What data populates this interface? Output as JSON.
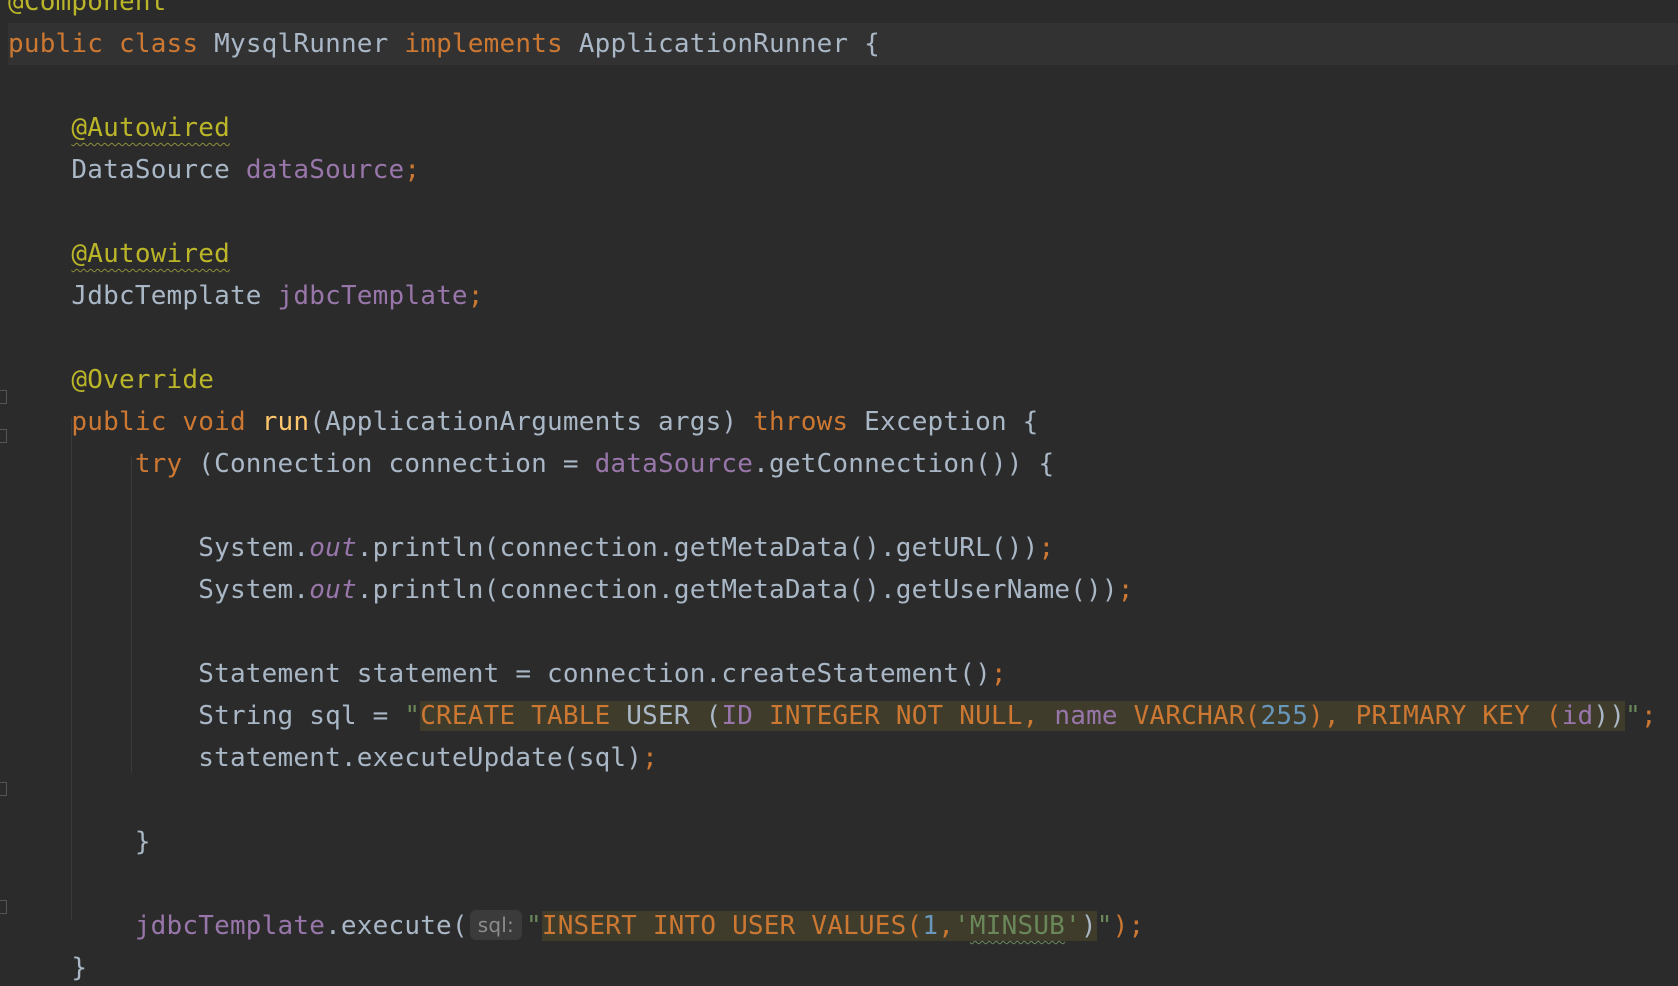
{
  "editor": {
    "lines": {
      "l0": {
        "annotation": "@Component"
      },
      "l1": {
        "kw_public": "public",
        "sp1": " ",
        "kw_class": "class",
        "sp2": " ",
        "class_name": "MysqlRunner",
        "sp3": " ",
        "kw_implements": "implements",
        "sp4": " ",
        "iface": "ApplicationRunner",
        "brace": " {"
      },
      "l3": {
        "indent": "    ",
        "annotation": "@Autowired"
      },
      "l4": {
        "indent": "    ",
        "type": "DataSource",
        "sp": " ",
        "field": "dataSource",
        "semi": ";"
      },
      "l6": {
        "indent": "    ",
        "annotation": "@Autowired"
      },
      "l7": {
        "indent": "    ",
        "type": "JdbcTemplate",
        "sp": " ",
        "field": "jdbcTemplate",
        "semi": ";"
      },
      "l9": {
        "indent": "    ",
        "annotation": "@Override"
      },
      "l10": {
        "indent": "    ",
        "kw_public": "public",
        "sp1": " ",
        "kw_void": "void",
        "sp2": " ",
        "method": "run",
        "params": "(ApplicationArguments args)",
        "sp3": " ",
        "kw_throws": "throws",
        "rest": " Exception {"
      },
      "l11": {
        "indent": "        ",
        "kw_try": "try",
        "p1": " (Connection connection = ",
        "field": "dataSource",
        "p2": ".getConnection()) {"
      },
      "l13": {
        "indent": "            ",
        "cls": "System.",
        "static_field": "out",
        "call": ".println(connection.getMetaData().getURL())",
        "semi": ";"
      },
      "l14": {
        "indent": "            ",
        "cls": "System.",
        "static_field": "out",
        "call": ".println(connection.getMetaData().getUserName())",
        "semi": ";"
      },
      "l16": {
        "indent": "            ",
        "code": "Statement statement = connection.createStatement()",
        "semi": ";"
      },
      "l17": {
        "indent": "            ",
        "code": "String sql = ",
        "quote_open": "\"",
        "sql": {
          "t1": "CREATE TABLE",
          "t2": " USER ",
          "t3": "(",
          "t4": "ID",
          "t5": " INTEGER NOT NULL, ",
          "t6": "name",
          "t7": " VARCHAR(",
          "t8": "255",
          "t9": "), PRIMARY KEY (",
          "t10": "id",
          "t11": "))"
        },
        "quote_close": "\"",
        "semi": ";"
      },
      "l18": {
        "indent": "            ",
        "code": "statement.executeUpdate(sql)",
        "semi": ";"
      },
      "l20": {
        "indent": "        ",
        "brace": "}"
      },
      "l22": {
        "indent": "        ",
        "field": "jdbcTemplate",
        "call": ".execute(",
        "hint": "sql:",
        "quote_open": "\"",
        "sql": {
          "t1": "INSERT INTO USER VALUES(",
          "t2": "1",
          "t3": ",",
          "t4": "'",
          "t5": "MINSUB",
          "t6": "'",
          "t7": ")"
        },
        "quote_close": "\"",
        "end": ");"
      },
      "l23": {
        "indent": "    ",
        "brace": "}"
      }
    }
  }
}
